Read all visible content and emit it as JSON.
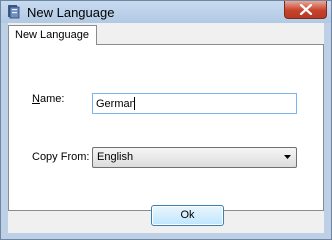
{
  "window": {
    "title": "New Language",
    "icon": "app-icon",
    "close_icon": "close-icon"
  },
  "tabs": [
    {
      "label": "New Language",
      "selected": true
    }
  ],
  "form": {
    "name_label_mnemonic": "N",
    "name_label_rest": "ame:",
    "name_value": "German",
    "copy_from_label": "Copy From:",
    "copy_from_selected": "English"
  },
  "buttons": {
    "ok_label": "Ok"
  },
  "colors": {
    "accent_border": "#7eb4ea",
    "close_red": "#c7422a",
    "frame": "#bdd0e6"
  }
}
